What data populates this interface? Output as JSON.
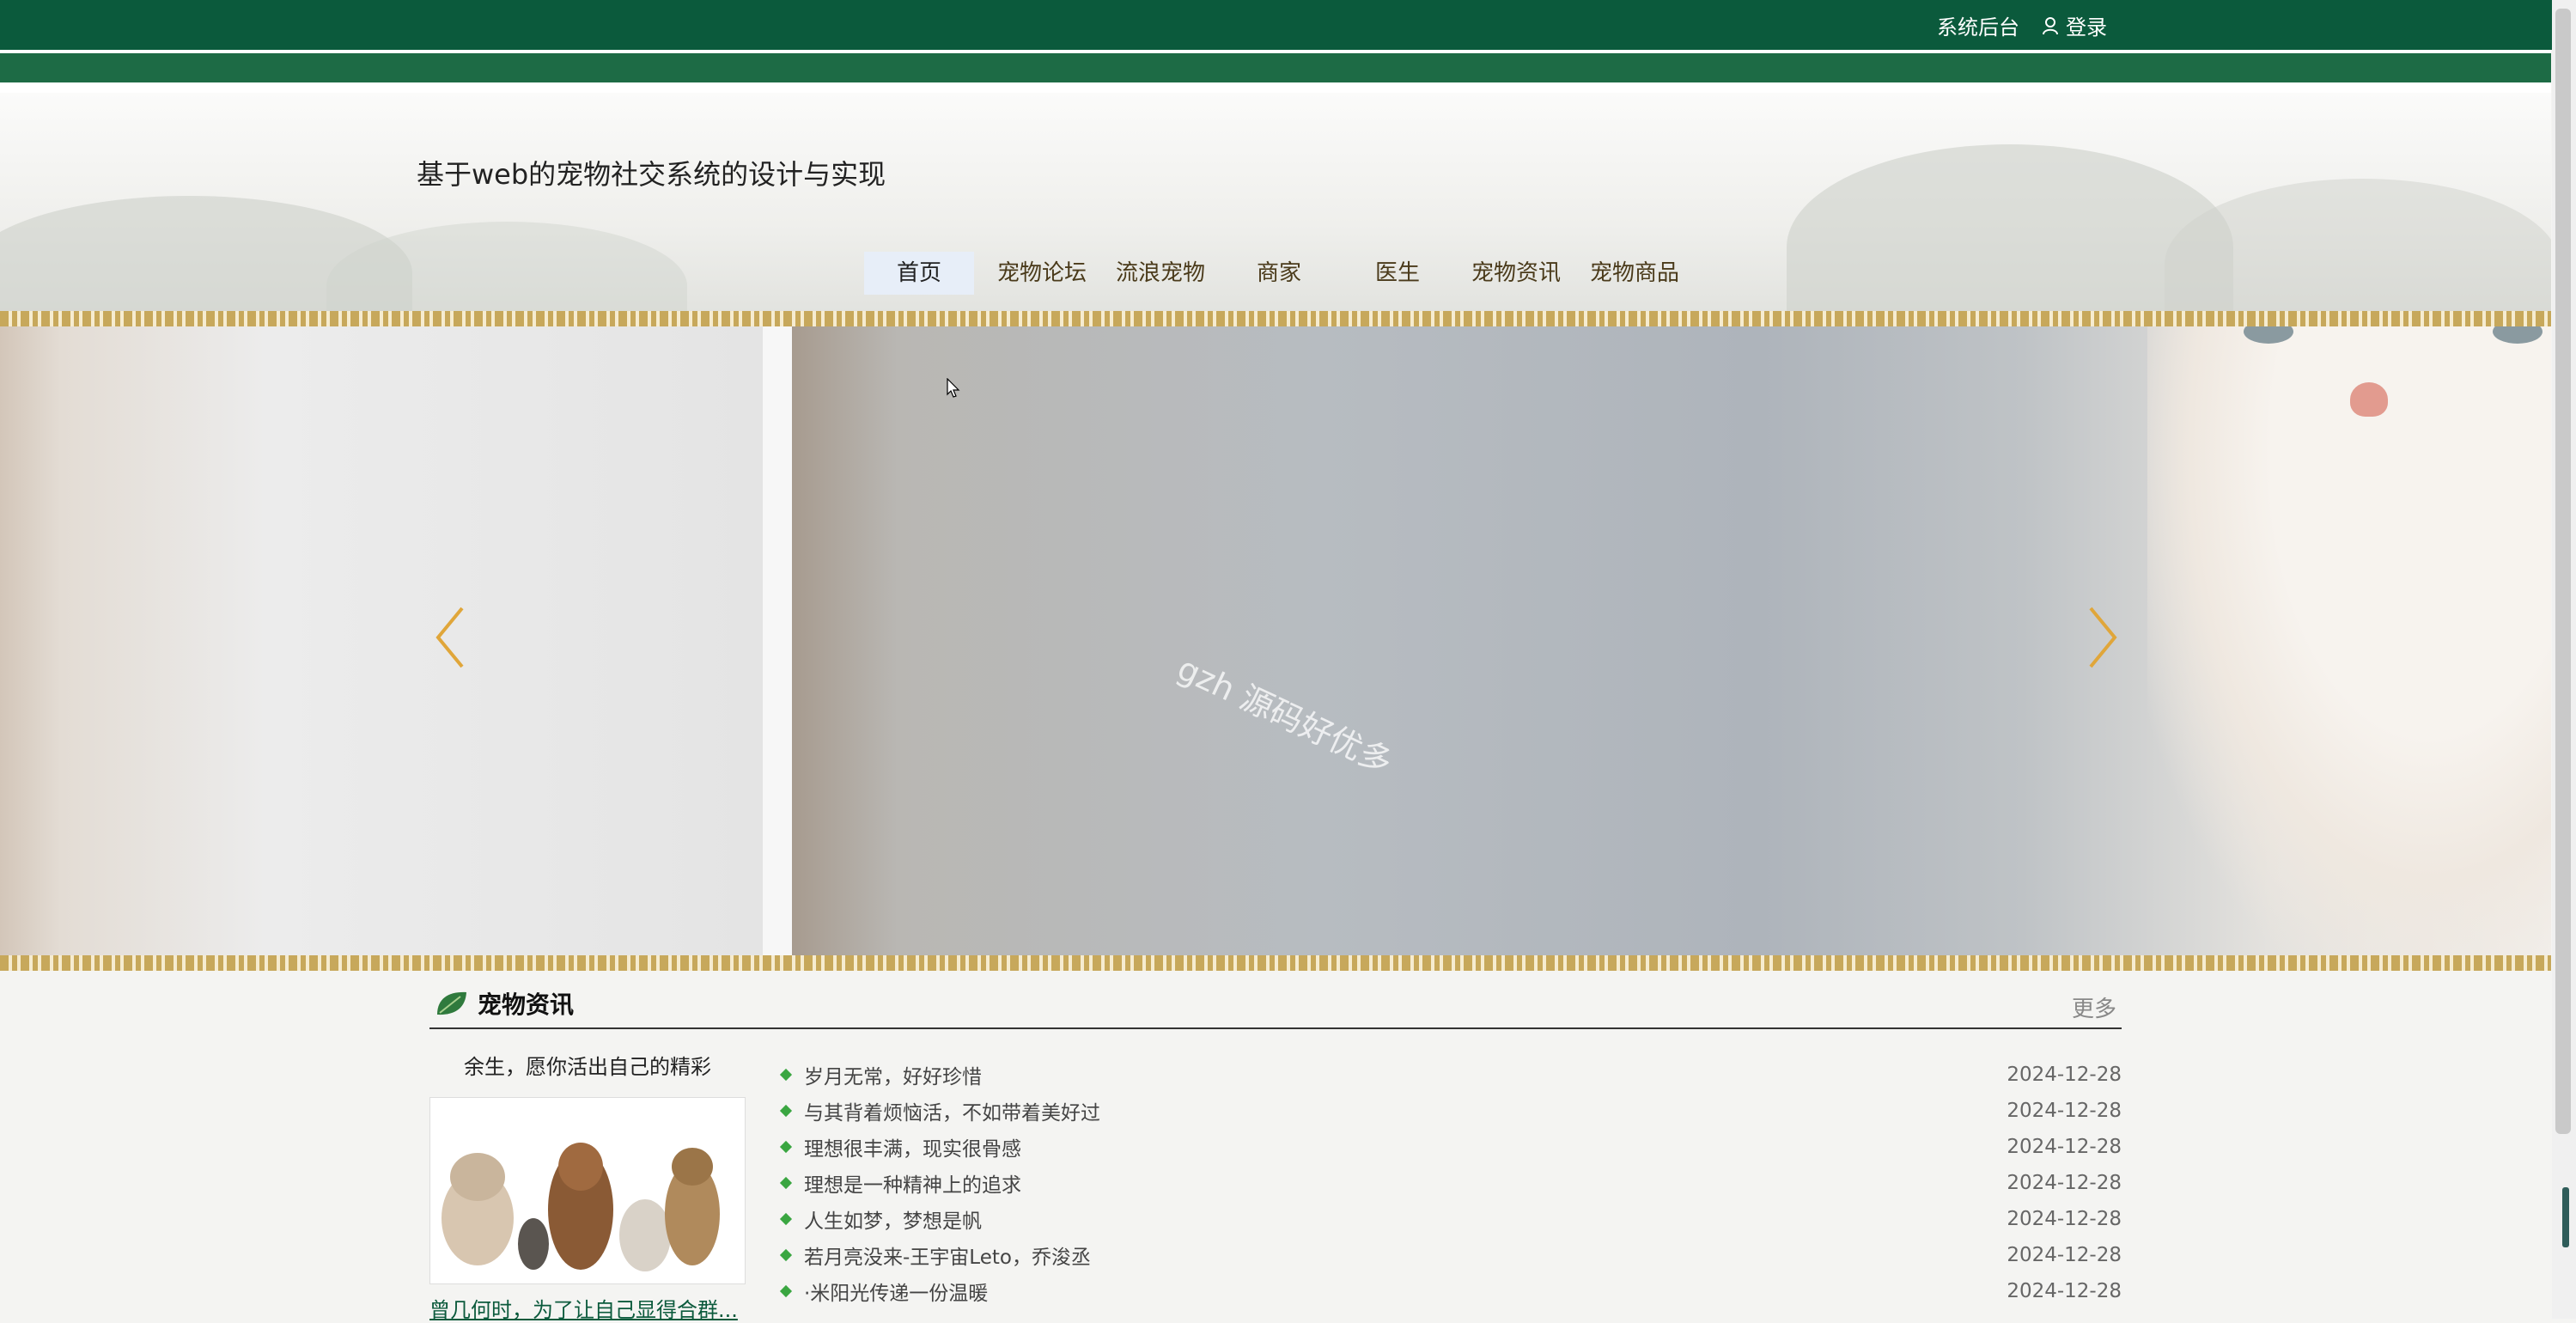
{
  "topbar": {
    "admin_label": "系统后台",
    "login_label": "登录"
  },
  "header": {
    "site_title": "基于web的宠物社交系统的设计与实现"
  },
  "nav": {
    "items": [
      "首页",
      "宠物论坛",
      "流浪宠物",
      "商家",
      "医生",
      "宠物资讯",
      "宠物商品"
    ],
    "active_index": 0
  },
  "banner": {
    "watermark": "gzh 源码好优多",
    "arrow_color": "#e0a63a"
  },
  "news": {
    "title": "宠物资讯",
    "more_label": "更多",
    "featured": {
      "caption": "余生，愿你活出自己的精彩",
      "link": "曾几何时，为了让自己显得合群..."
    },
    "items": [
      {
        "title": "岁月无常，好好珍惜",
        "date": "2024-12-28"
      },
      {
        "title": "与其背着烦恼活，不如带着美好过",
        "date": "2024-12-28"
      },
      {
        "title": "理想很丰满，现实很骨感",
        "date": "2024-12-28"
      },
      {
        "title": "理想是一种精神上的追求",
        "date": "2024-12-28"
      },
      {
        "title": "人生如梦，梦想是帆",
        "date": "2024-12-28"
      },
      {
        "title": "若月亮没来-王宇宙Leto，乔浚丞",
        "date": "2024-12-28"
      },
      {
        "title": "·米阳光传递一份温暖",
        "date": "2024-12-28"
      }
    ]
  },
  "colors": {
    "topbar": "#0b5a3c",
    "accent_green": "#3aa641",
    "nav_active_bg": "#e7eef8"
  }
}
